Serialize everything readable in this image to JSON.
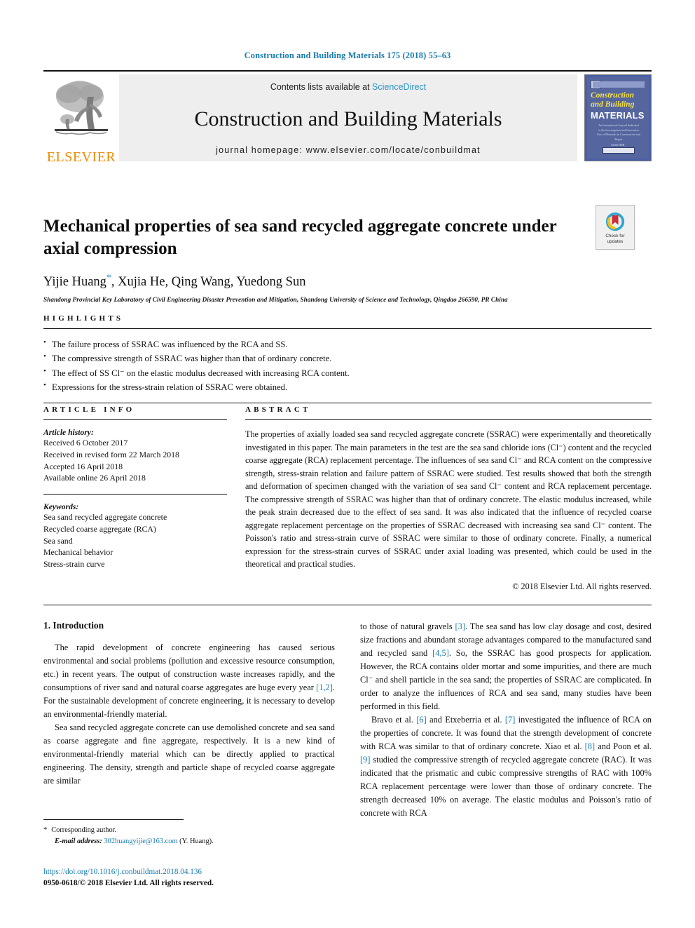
{
  "running_head": "Construction and Building Materials 175 (2018) 55–63",
  "masthead": {
    "publisher": "ELSEVIER",
    "contents_prefix": "Contents lists available at ",
    "contents_link": "ScienceDirect",
    "journal_title": "Construction and Building Materials",
    "homepage": "journal homepage: www.elsevier.com/locate/conbuildmat",
    "cover": {
      "line1": "Construction",
      "line2": "and Building",
      "line3": "MATERIALS",
      "blurb": "An International Journal dedicated to the Investigation and Innovative Use of Materials in Construction and Repair",
      "footer": "ELSEVIER"
    }
  },
  "article": {
    "title": "Mechanical properties of sea sand recycled aggregate concrete under axial compression",
    "authors": "Yijie Huang",
    "authors_rest": ", Xujia He, Qing Wang, Yuedong Sun",
    "corresponding_marker": "*",
    "affiliation": "Shandong Provincial Key Laboratory of Civil Engineering Disaster Prevention and Mitigation, Shandong University of Science and Technology, Qingdao 266590, PR China",
    "crossmark_line1": "Check for",
    "crossmark_line2": "updates"
  },
  "highlights": {
    "heading": "HIGHLIGHTS",
    "items": [
      "The failure process of SSRAC was influenced by the RCA and SS.",
      "The compressive strength of SSRAC was higher than that of ordinary concrete.",
      "The effect of SS Cl⁻ on the elastic modulus decreased with increasing RCA content.",
      "Expressions for the stress-strain relation of SSRAC were obtained."
    ]
  },
  "article_info": {
    "heading": "ARTICLE INFO",
    "history_label": "Article history:",
    "history": [
      "Received 6 October 2017",
      "Received in revised form 22 March 2018",
      "Accepted 16 April 2018",
      "Available online 26 April 2018"
    ],
    "keywords_label": "Keywords:",
    "keywords": [
      "Sea sand recycled aggregate concrete",
      "Recycled coarse aggregate (RCA)",
      "Sea sand",
      "Mechanical behavior",
      "Stress-strain curve"
    ]
  },
  "abstract": {
    "heading": "ABSTRACT",
    "text": "The properties of axially loaded sea sand recycled aggregate concrete (SSRAC) were experimentally and theoretically investigated in this paper. The main parameters in the test are the sea sand chloride ions (Cl⁻) content and the recycled coarse aggregate (RCA) replacement percentage. The influences of sea sand Cl⁻ and RCA content on the compressive strength, stress-strain relation and failure pattern of SSRAC were studied. Test results showed that both the strength and deformation of specimen changed with the variation of sea sand Cl⁻ content and RCA replacement percentage. The compressive strength of SSRAC was higher than that of ordinary concrete. The elastic modulus increased, while the peak strain decreased due to the effect of sea sand. It was also indicated that the influence of recycled coarse aggregate replacement percentage on the properties of SSRAC decreased with increasing sea sand Cl⁻ content. The Poisson's ratio and stress-strain curve of SSRAC were similar to those of ordinary concrete. Finally, a numerical expression for the stress-strain curves of SSRAC under axial loading was presented, which could be used in the theoretical and practical studies.",
    "copyright": "© 2018 Elsevier Ltd. All rights reserved."
  },
  "body": {
    "section_heading": "1. Introduction",
    "left_para_1_a": "The rapid development of concrete engineering has caused serious environmental and social problems (pollution and excessive resource consumption, etc.) in recent years. The output of construction waste increases rapidly, and the consumptions of river sand and natural coarse aggregates are huge every year ",
    "left_para_1_ref": "[1,2]",
    "left_para_1_b": ". For the sustainable development of concrete engineering, it is necessary to develop an environmental-friendly material.",
    "left_para_2": "Sea sand recycled aggregate concrete can use demolished concrete and sea sand as coarse aggregate and fine aggregate, respectively. It is a new kind of environmental-friendly material which can be directly applied to practical engineering. The density, strength and particle shape of recycled coarse aggregate are similar",
    "right_para_1_a": "to those of natural gravels ",
    "right_para_1_ref1": "[3]",
    "right_para_1_b": ". The sea sand has low clay dosage and cost, desired size fractions and abundant storage advantages compared to the manufactured sand and recycled sand ",
    "right_para_1_ref2": "[4,5]",
    "right_para_1_c": ". So, the SSRAC has good prospects for application. However, the RCA contains older mortar and some impurities, and there are much Cl⁻ and shell particle in the sea sand; the properties of SSRAC are complicated. In order to analyze the influences of RCA and sea sand, many studies have been performed in this field.",
    "right_para_2_a": "Bravo et al. ",
    "right_para_2_ref1": "[6]",
    "right_para_2_b": " and Etxeberria et al. ",
    "right_para_2_ref2": "[7]",
    "right_para_2_c": " investigated the influence of RCA on the properties of concrete. It was found that the strength development of concrete with RCA was similar to that of ordinary concrete. Xiao et al. ",
    "right_para_2_ref3": "[8]",
    "right_para_2_d": " and Poon et al. ",
    "right_para_2_ref4": "[9]",
    "right_para_2_e": " studied the compressive strength of recycled aggregate concrete (RAC). It was indicated that the prismatic and cubic compressive strengths of RAC with 100% RCA replacement percentage were lower than those of ordinary concrete. The strength decreased 10% on average. The elastic modulus and Poisson's ratio of concrete with RCA"
  },
  "footer": {
    "corresponding_star": "*",
    "corresponding_label": "Corresponding author.",
    "email_label": "E-mail address:",
    "email": "302huangyijie@163.com",
    "email_owner": " (Y. Huang).",
    "doi": "https://doi.org/10.1016/j.conbuildmat.2018.04.136",
    "issn": "0950-0618/© 2018 Elsevier Ltd. All rights reserved."
  },
  "colors": {
    "link": "#1a7bb0",
    "science_direct": "#2b93c8",
    "elsevier_orange": "#ED8B00",
    "cover_blue": "#4a5fa5"
  }
}
